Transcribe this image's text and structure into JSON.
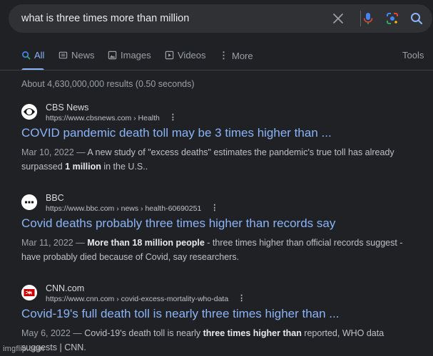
{
  "search": {
    "query": "what is three times more than million"
  },
  "tabs": [
    {
      "label": "All"
    },
    {
      "label": "News"
    },
    {
      "label": "Images"
    },
    {
      "label": "Videos"
    },
    {
      "label": "More"
    }
  ],
  "tools_label": "Tools",
  "result_stats": "About 4,630,000,000 results (0.50 seconds)",
  "results": [
    {
      "site_name": "CBS News",
      "url": "https://www.cbsnews.com › Health",
      "title": "COVID pandemic death toll may be 3 times higher than ...",
      "date": "Mar 10, 2022 —",
      "snippet_1": " A new study of \"excess deaths\" estimates the pandemic's true toll has already surpassed ",
      "snippet_bold_1": "1 million",
      "snippet_2": " in the U.S..",
      "snippet_bold_2": "",
      "snippet_3": ""
    },
    {
      "site_name": "BBC",
      "url": "https://www.bbc.com › news › health-60690251",
      "title": "Covid deaths probably three times higher than records say",
      "date": "Mar 11, 2022 —",
      "snippet_1": " ",
      "snippet_bold_1": "More than 18 million people",
      "snippet_2": " - three times higher than official records suggest - have probably died because of Covid, say researchers.",
      "snippet_bold_2": "",
      "snippet_3": ""
    },
    {
      "site_name": "CNN.com",
      "url": "https://www.cnn.com › covid-excess-mortality-who-data",
      "title": "Covid-19's full death toll is nearly three times higher than ...",
      "date": "May 6, 2022 —",
      "snippet_1": " Covid-19's death toll is nearly ",
      "snippet_bold_1": "three times higher than",
      "snippet_2": " reported, WHO data suggests | CNN.",
      "snippet_bold_2": "",
      "snippet_3": ""
    }
  ],
  "icons": {
    "clear": "close-icon",
    "voice": "microphone-icon",
    "lens": "camera-lens-icon",
    "search": "search-icon"
  },
  "colors": {
    "background": "#202124",
    "link": "#8ab4f8",
    "text": "#bdc1c6"
  },
  "watermark": "imgflip.com"
}
